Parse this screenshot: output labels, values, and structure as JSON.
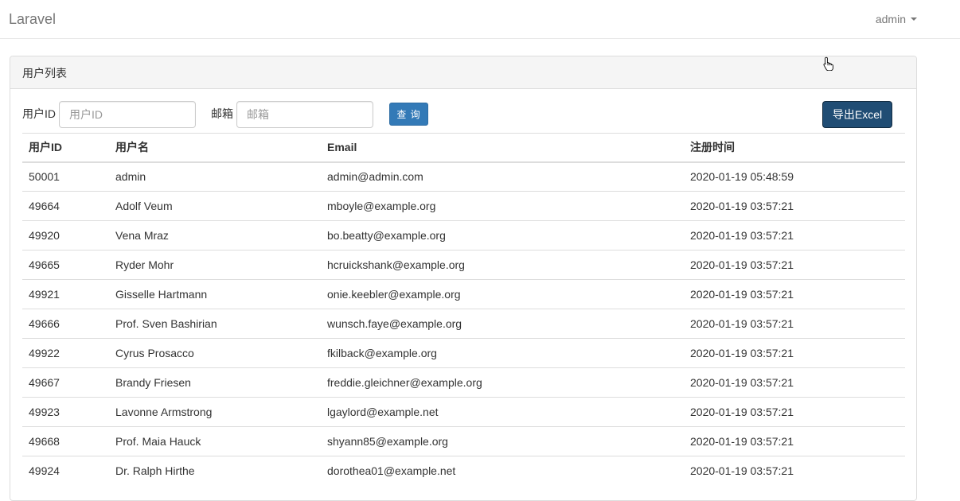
{
  "navbar": {
    "brand": "Laravel",
    "user": "admin"
  },
  "panel": {
    "title": "用户列表"
  },
  "filters": {
    "user_id_label": "用户ID",
    "user_id_placeholder": "用户ID",
    "user_id_value": "",
    "email_label": "邮箱",
    "email_placeholder": "邮箱",
    "email_value": "",
    "query_button": "查 询",
    "export_button": "导出Excel"
  },
  "table": {
    "headers": [
      "用户ID",
      "用户名",
      "Email",
      "注册时间"
    ],
    "rows": [
      [
        "50001",
        "admin",
        "admin@admin.com",
        "2020-01-19 05:48:59"
      ],
      [
        "49664",
        "Adolf Veum",
        "mboyle@example.org",
        "2020-01-19 03:57:21"
      ],
      [
        "49920",
        "Vena Mraz",
        "bo.beatty@example.org",
        "2020-01-19 03:57:21"
      ],
      [
        "49665",
        "Ryder Mohr",
        "hcruickshank@example.org",
        "2020-01-19 03:57:21"
      ],
      [
        "49921",
        "Gisselle Hartmann",
        "onie.keebler@example.org",
        "2020-01-19 03:57:21"
      ],
      [
        "49666",
        "Prof. Sven Bashirian",
        "wunsch.faye@example.org",
        "2020-01-19 03:57:21"
      ],
      [
        "49922",
        "Cyrus Prosacco",
        "fkilback@example.org",
        "2020-01-19 03:57:21"
      ],
      [
        "49667",
        "Brandy Friesen",
        "freddie.gleichner@example.org",
        "2020-01-19 03:57:21"
      ],
      [
        "49923",
        "Lavonne Armstrong",
        "lgaylord@example.net",
        "2020-01-19 03:57:21"
      ],
      [
        "49668",
        "Prof. Maia Hauck",
        "shyann85@example.org",
        "2020-01-19 03:57:21"
      ],
      [
        "49924",
        "Dr. Ralph Hirthe",
        "dorothea01@example.net",
        "2020-01-19 03:57:21"
      ]
    ]
  },
  "colors": {
    "primary": "#337ab7",
    "primary_active": "#204d74",
    "border": "#dddddd",
    "panel_heading_bg": "#f5f5f5"
  },
  "icons": {
    "cursor": "hand-pointer-icon",
    "user_menu_caret": "caret-down-icon"
  }
}
